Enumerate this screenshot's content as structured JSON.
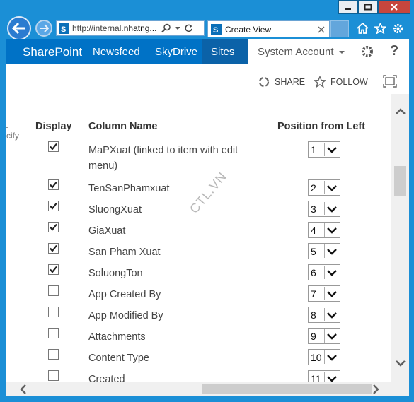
{
  "browser": {
    "address_prefix": "http://internal.",
    "address_host": "nhatng...",
    "tab_title": "Create View"
  },
  "suite_bar": {
    "brand": "SharePoint",
    "links": [
      "Newsfeed",
      "SkyDrive",
      "Sites"
    ],
    "active_link": "Sites",
    "account": "System Account"
  },
  "actions": {
    "share": "SHARE",
    "follow": "FOLLOW"
  },
  "columns_table": {
    "left_fragment": "cify",
    "headers": {
      "display": "Display",
      "column_name": "Column Name",
      "position": "Position from Left"
    },
    "rows": [
      {
        "checked": true,
        "name": "MaPXuat (linked to item with edit menu)",
        "position": "1"
      },
      {
        "checked": true,
        "name": "TenSanPhamxuat",
        "position": "2"
      },
      {
        "checked": true,
        "name": "SluongXuat",
        "position": "3"
      },
      {
        "checked": true,
        "name": "GiaXuat",
        "position": "4"
      },
      {
        "checked": true,
        "name": "San Pham Xuat",
        "position": "5"
      },
      {
        "checked": true,
        "name": "SoluongTon",
        "position": "6"
      },
      {
        "checked": false,
        "name": "App Created By",
        "position": "7"
      },
      {
        "checked": false,
        "name": "App Modified By",
        "position": "8"
      },
      {
        "checked": false,
        "name": "Attachments",
        "position": "9"
      },
      {
        "checked": false,
        "name": "Content Type",
        "position": "10"
      },
      {
        "checked": false,
        "name": "Created",
        "position": "11"
      }
    ]
  },
  "watermark": "CTL.VN",
  "colors": {
    "frame": "#1b8fd6",
    "suite_blue": "#0072c6",
    "close_red": "#c7463d"
  }
}
